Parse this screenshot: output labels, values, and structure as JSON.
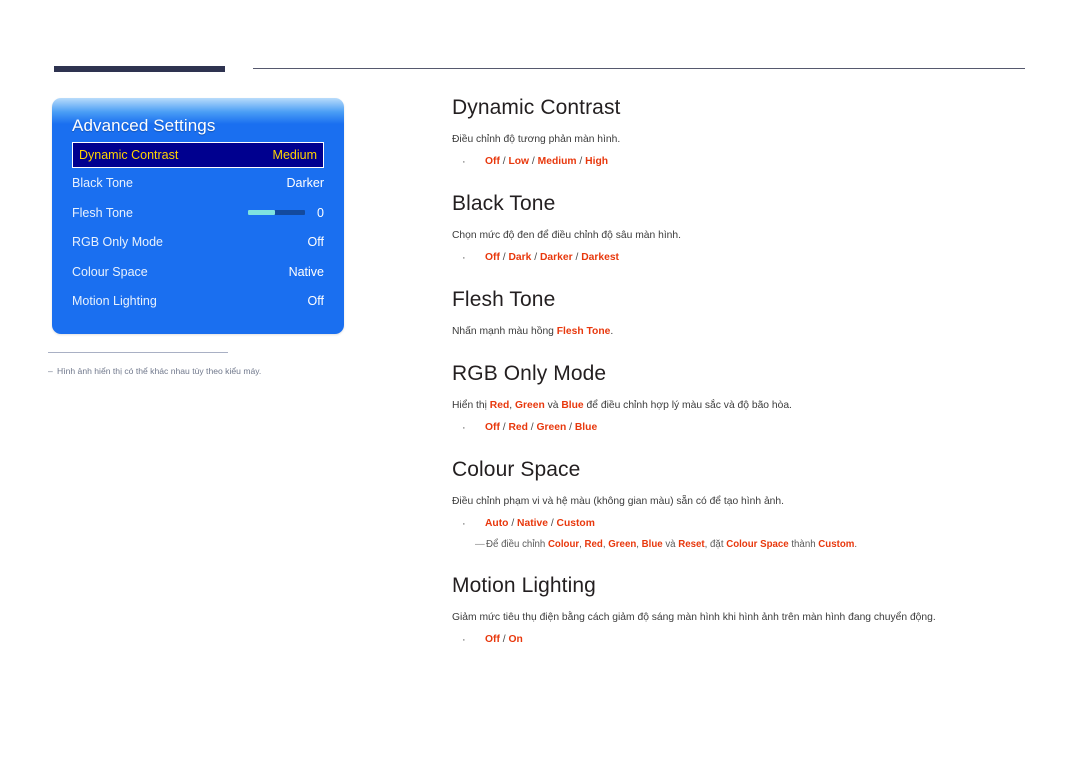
{
  "header": {
    "accent_bar_color": "#2e3350",
    "rule_color": "#56596e"
  },
  "osd": {
    "title": "Advanced Settings",
    "rows": [
      {
        "label": "Dynamic Contrast",
        "value": "Medium",
        "selected": true,
        "type": "value"
      },
      {
        "label": "Black Tone",
        "value": "Darker",
        "selected": false,
        "type": "value"
      },
      {
        "label": "Flesh Tone",
        "value": "0",
        "selected": false,
        "type": "slider",
        "slider_fill_percent": 48
      },
      {
        "label": "RGB Only Mode",
        "value": "Off",
        "selected": false,
        "type": "value"
      },
      {
        "label": "Colour Space",
        "value": "Native",
        "selected": false,
        "type": "value"
      },
      {
        "label": "Motion Lighting",
        "value": "Off",
        "selected": false,
        "type": "value"
      }
    ],
    "colors": {
      "panel_blue": "#1a6ff0",
      "selected_bg": "#00008f",
      "selected_text": "#ffd400",
      "slider_fill": "#7fe3e0",
      "slider_track": "#134a9e"
    }
  },
  "footnote": {
    "dash": "–",
    "text": "Hình ảnh hiển thị có thể khác nhau tùy theo kiểu máy."
  },
  "sections": {
    "dynamic_contrast": {
      "title": "Dynamic Contrast",
      "desc": "Điều chỉnh độ tương phản màn hình.",
      "opt1": "Off",
      "opt2": "Low",
      "opt3": "Medium",
      "opt4": "High"
    },
    "black_tone": {
      "title": "Black Tone",
      "desc": "Chọn mức độ đen để điều chỉnh độ sâu màn hình.",
      "opt1": "Off",
      "opt2": "Dark",
      "opt3": "Darker",
      "opt4": "Darkest"
    },
    "flesh_tone": {
      "title": "Flesh Tone",
      "desc_before": "Nhấn mạnh màu hồng ",
      "desc_kw": "Flesh Tone",
      "desc_after": "."
    },
    "rgb_only_mode": {
      "title": "RGB Only Mode",
      "desc_a": "Hiển thị ",
      "desc_kw1": "Red",
      "desc_b": ", ",
      "desc_kw2": "Green",
      "desc_c": " và ",
      "desc_kw3": "Blue",
      "desc_d": " để điều chỉnh hợp lý màu sắc và độ bão hòa.",
      "opt1": "Off",
      "opt2": "Red",
      "opt3": "Green",
      "opt4": "Blue"
    },
    "colour_space": {
      "title": "Colour Space",
      "desc": "Điều chỉnh phạm vi và hệ màu (không gian màu) sẵn có để tạo hình ảnh.",
      "opt1": "Auto",
      "opt2": "Native",
      "opt3": "Custom",
      "note_dash": "—",
      "note_a": "Để điều chỉnh ",
      "note_kw1": "Colour",
      "note_b": ", ",
      "note_kw2": "Red",
      "note_c": ", ",
      "note_kw3": "Green",
      "note_d": ", ",
      "note_kw4": "Blue",
      "note_e": " và ",
      "note_kw5": "Reset",
      "note_f": ", đặt ",
      "note_kw6": "Colour Space",
      "note_g": " thành ",
      "note_kw7": "Custom",
      "note_h": "."
    },
    "motion_lighting": {
      "title": "Motion Lighting",
      "desc": "Giảm mức tiêu thụ điện bằng cách giảm độ sáng màn hình khi hình ảnh trên màn hình đang chuyển động.",
      "opt1": "Off",
      "opt2": "On"
    }
  },
  "separators": {
    "slash": "/",
    "bullet": "·"
  },
  "accent_color": "#e8380d"
}
